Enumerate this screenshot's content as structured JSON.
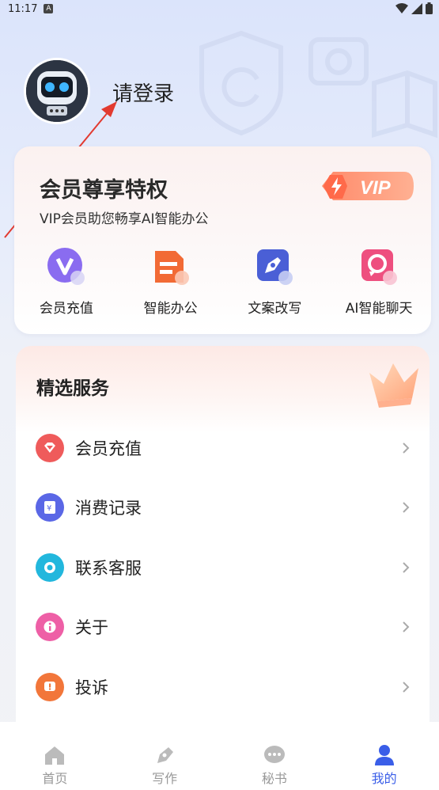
{
  "status_bar": {
    "time": "11:17",
    "notif_letter": "A"
  },
  "profile": {
    "login_label": "请登录"
  },
  "vip": {
    "title": "会员尊享特权",
    "subtitle": "VIP会员助您畅享AI智能办公",
    "badge": "VIP",
    "features": [
      {
        "label": "会员充值",
        "icon": "vip-v-icon"
      },
      {
        "label": "智能办公",
        "icon": "document-icon"
      },
      {
        "label": "文案改写",
        "icon": "pen-icon"
      },
      {
        "label": "AI智能聊天",
        "icon": "chat-icon"
      }
    ]
  },
  "services": {
    "title": "精选服务",
    "items": [
      {
        "label": "会员充值",
        "icon": "diamond-icon",
        "color": "#ef5b5b"
      },
      {
        "label": "消费记录",
        "icon": "receipt-icon",
        "color": "#5a67e6"
      },
      {
        "label": "联系客服",
        "icon": "headset-icon",
        "color": "#22b7dd"
      },
      {
        "label": "关于",
        "icon": "info-icon",
        "color": "#ee5fa6"
      },
      {
        "label": "投诉",
        "icon": "alert-icon",
        "color": "#f2763a"
      }
    ]
  },
  "nav": {
    "items": [
      {
        "label": "首页",
        "icon": "home-icon"
      },
      {
        "label": "写作",
        "icon": "pen-nav-icon"
      },
      {
        "label": "秘书",
        "icon": "chat-bubble-icon"
      },
      {
        "label": "我的",
        "icon": "person-icon"
      }
    ],
    "active_color": "#3a5ee8",
    "inactive_color": "#bbbbbb"
  }
}
